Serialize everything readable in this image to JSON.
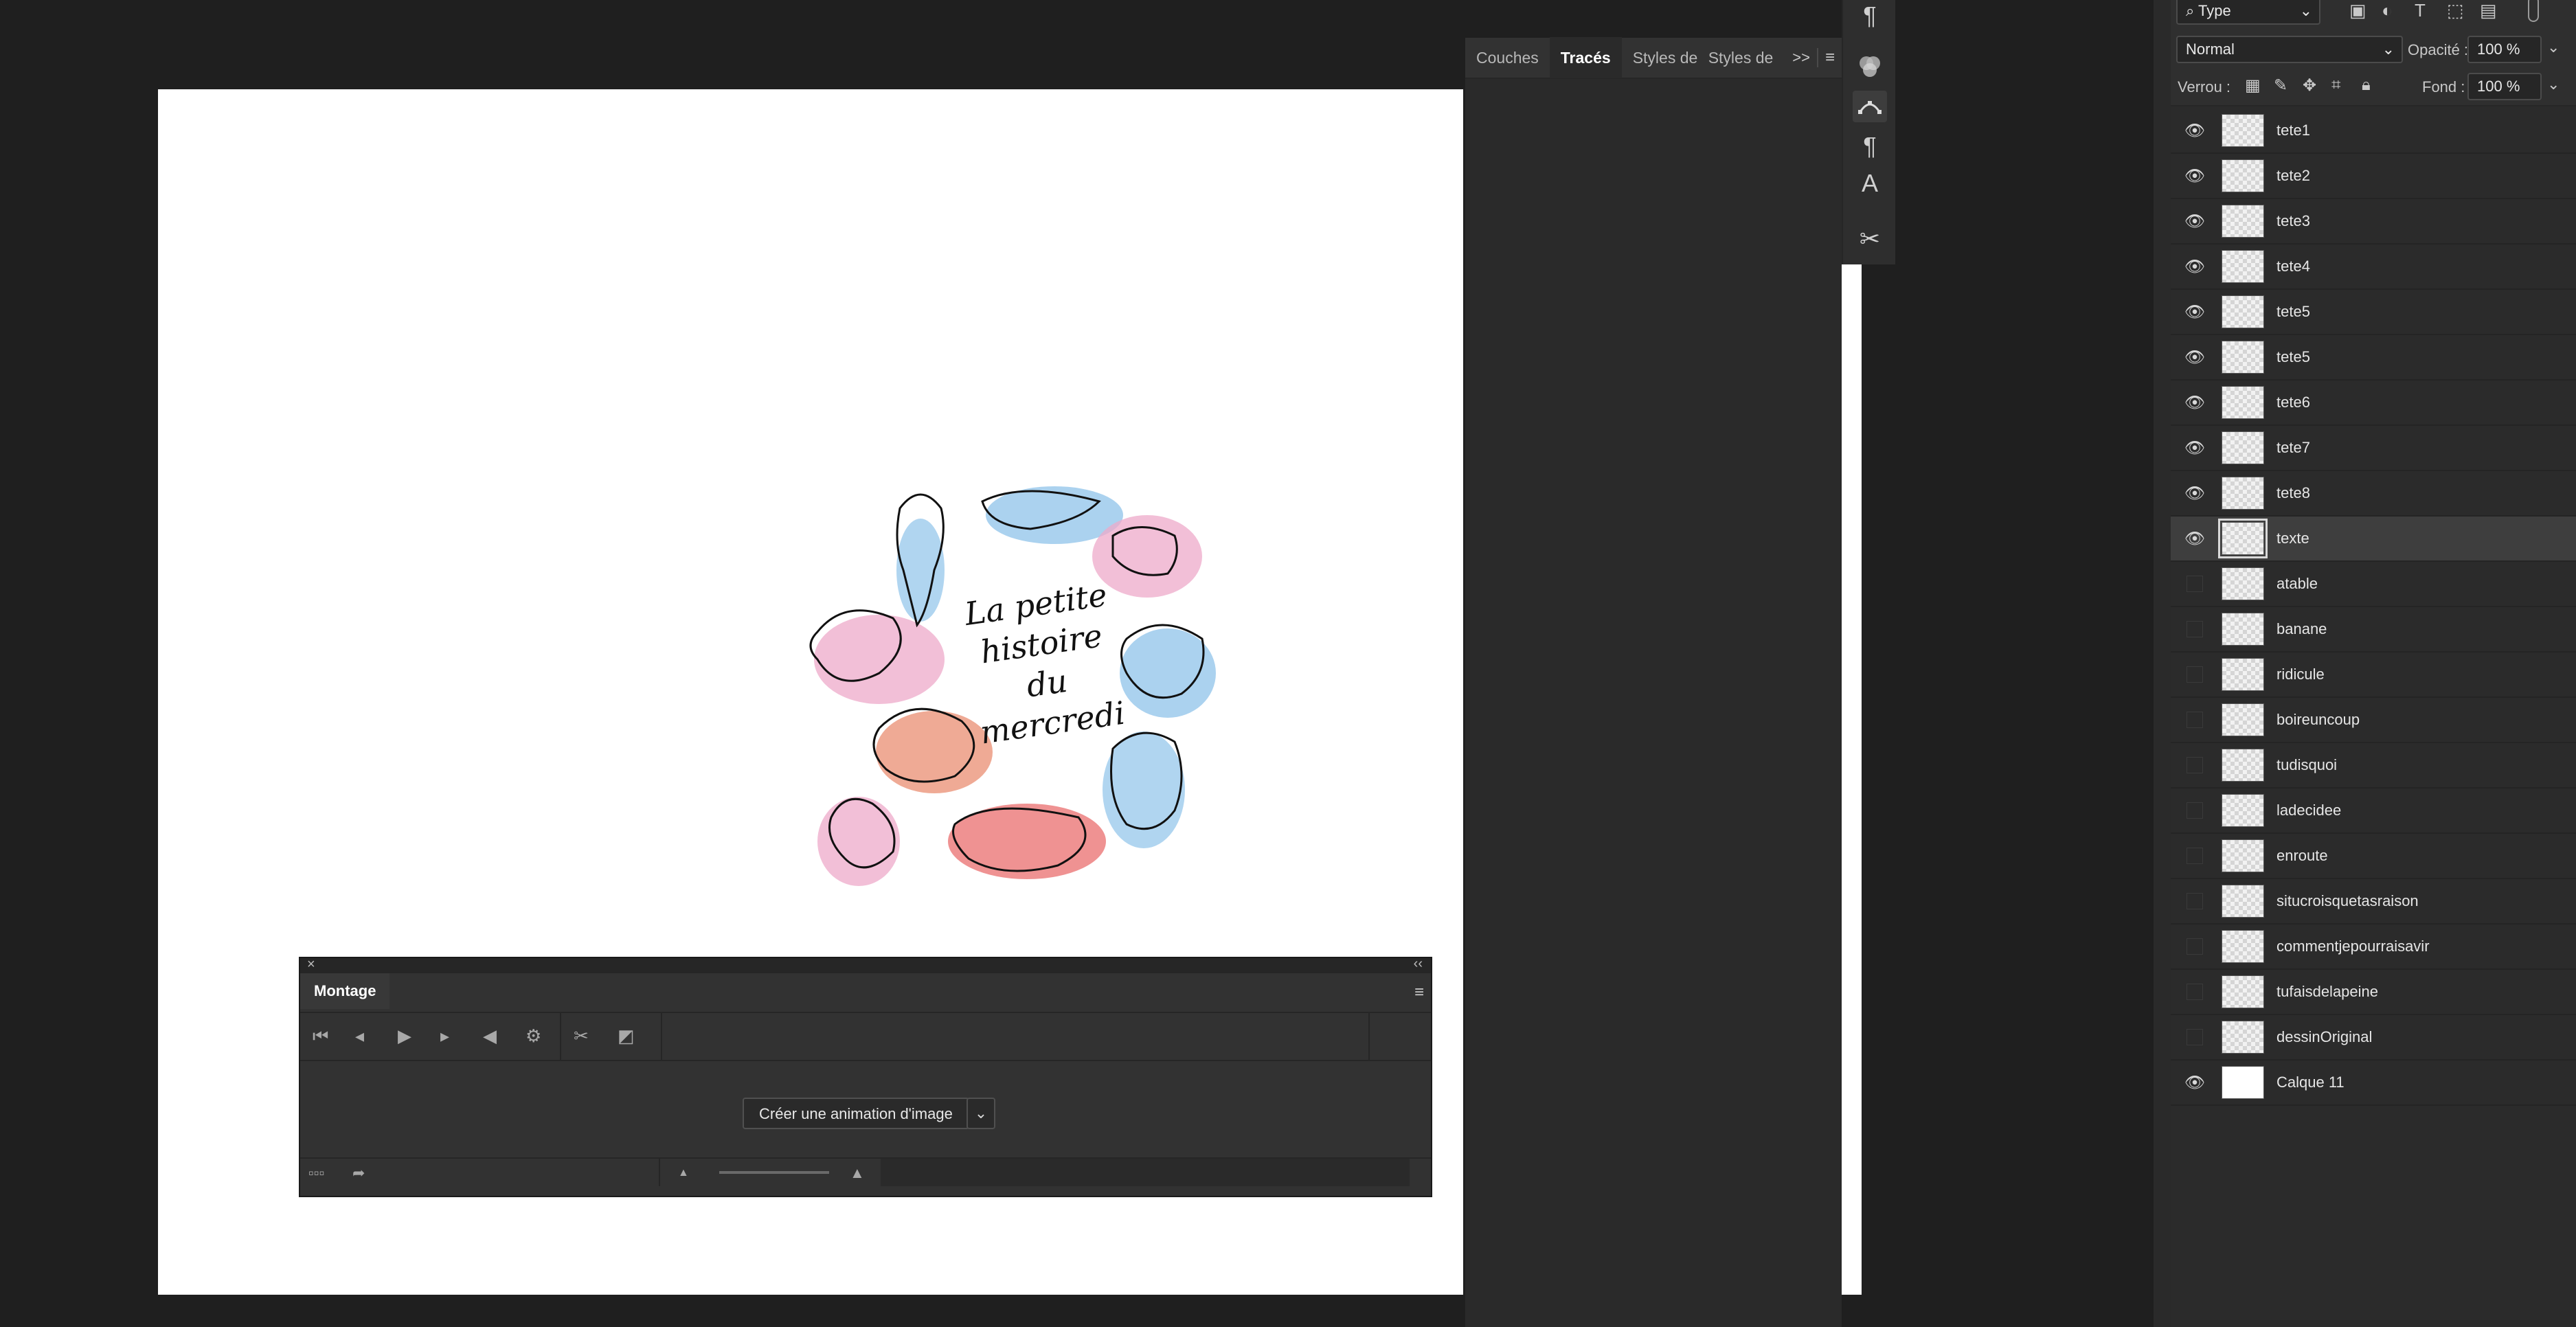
{
  "tabs": {
    "items": [
      "Couches",
      "Tracés",
      "Styles de",
      "Styles de"
    ],
    "active": "Tracés",
    "more": ">>",
    "menu": "≡"
  },
  "toolstrip": {
    "icons": [
      "paragraph-icon",
      "color-channels-icon",
      "path-icon",
      "paragraph-style-icon",
      "character-style-icon",
      "tool-presets-icon"
    ]
  },
  "layers": {
    "filter": {
      "value": "Type",
      "icon": "search-icon"
    },
    "blend_mode": "Normal",
    "opacity_label": "Opacité :",
    "opacity_value": "100 %",
    "lock_label": "Verrou :",
    "fill_label": "Fond :",
    "fill_value": "100 %",
    "rows": [
      {
        "name": "tete1",
        "visible": true
      },
      {
        "name": "tete2",
        "visible": true
      },
      {
        "name": "tete3",
        "visible": true
      },
      {
        "name": "tete4",
        "visible": true
      },
      {
        "name": "tete5",
        "visible": true
      },
      {
        "name": "tete5",
        "visible": true
      },
      {
        "name": "tete6",
        "visible": true
      },
      {
        "name": "tete7",
        "visible": true
      },
      {
        "name": "tete8",
        "visible": true
      },
      {
        "name": "texte",
        "visible": true,
        "selected": true
      },
      {
        "name": "atable",
        "visible": false
      },
      {
        "name": "banane",
        "visible": false
      },
      {
        "name": "ridicule",
        "visible": false
      },
      {
        "name": "boireuncoup",
        "visible": false
      },
      {
        "name": "tudisquoi",
        "visible": false
      },
      {
        "name": "ladecidee",
        "visible": false
      },
      {
        "name": "enroute",
        "visible": false
      },
      {
        "name": "situcroisquetasraison",
        "visible": false
      },
      {
        "name": "commentjepourraisavir",
        "visible": false
      },
      {
        "name": "tufaisdelapeine",
        "visible": false
      },
      {
        "name": "dessinOriginal",
        "visible": false
      },
      {
        "name": "Calque 11",
        "visible": true,
        "solid": true
      }
    ]
  },
  "canvas": {
    "handwritten_text": [
      "La petite",
      "histoire",
      "du",
      "mercredi"
    ]
  },
  "timeline": {
    "title": "Montage",
    "create_button": "Créer une animation d'image",
    "close": "×",
    "collapse": "‹‹",
    "menu": "≡"
  },
  "colors": {
    "app_bg": "#1f1f1f",
    "panel_bg": "#2b2b2b",
    "canvas_bg": "#ffffff",
    "blue_wash": "#8fc3ea",
    "pink_wash": "#eeaac9",
    "red_wash": "#ea6d6d"
  }
}
